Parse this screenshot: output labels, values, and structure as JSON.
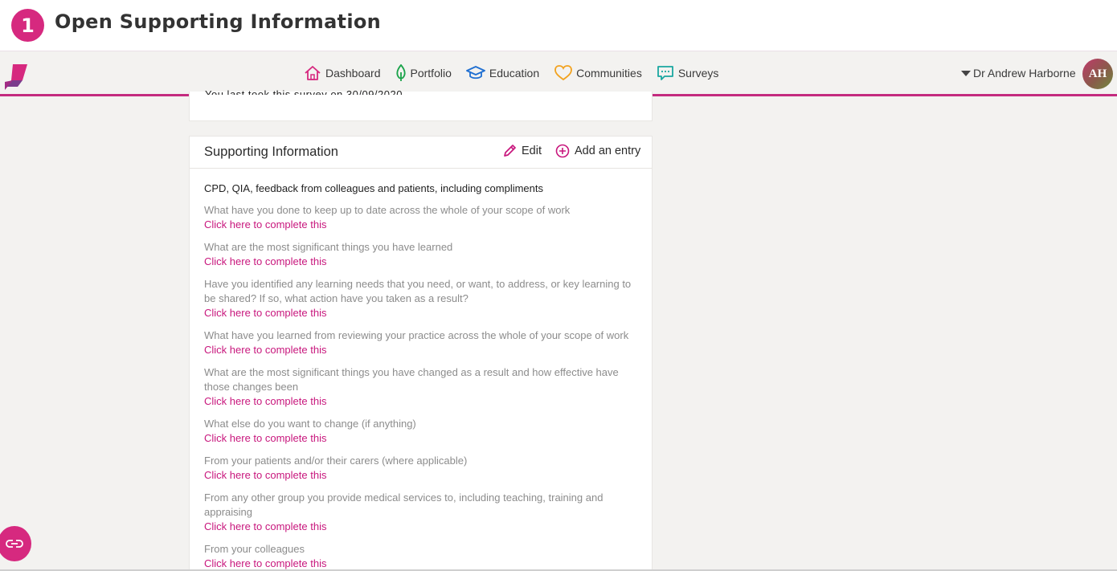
{
  "step": {
    "number": "1",
    "title": "Open Supporting Information"
  },
  "nav": {
    "items": [
      {
        "label": "Dashboard",
        "icon": "home-icon"
      },
      {
        "label": "Portfolio",
        "icon": "leaf-icon"
      },
      {
        "label": "Education",
        "icon": "graduation-cap-icon"
      },
      {
        "label": "Communities",
        "icon": "heart-icon"
      },
      {
        "label": "Surveys",
        "icon": "chat-icon"
      }
    ],
    "user_name": "Dr Andrew Harborne",
    "avatar_initials": "AH"
  },
  "top_card": {
    "clipped_text": "You last took this survey on 30/09/2020"
  },
  "supporting": {
    "title": "Supporting Information",
    "edit_label": "Edit",
    "add_label": "Add an entry",
    "section_heading": "CPD, QIA, feedback from colleagues and patients, including compliments",
    "questions": [
      {
        "text": "What have you done to keep up to date across the whole of your scope of work",
        "link": "Click here to complete this"
      },
      {
        "text": "What are the most significant things you have learned",
        "link": "Click here to complete this"
      },
      {
        "text": "Have you identified any learning needs that you need, or want, to address, or key learning to be shared? If so, what action have you taken as a result?",
        "link": "Click here to complete this"
      },
      {
        "text": "What have you learned from reviewing your practice across the whole of your scope of work",
        "link": "Click here to complete this"
      },
      {
        "text": "What are the most significant things you have changed as a result and how effective have those changes been",
        "link": "Click here to complete this"
      },
      {
        "text": "What else do you want to change (if anything)",
        "link": "Click here to complete this"
      },
      {
        "text": "From your patients and/or their carers (where applicable)",
        "link": "Click here to complete this"
      },
      {
        "text": "From any other group you provide medical services to, including teaching, training and appraising",
        "link": "Click here to complete this"
      },
      {
        "text": "From your colleagues",
        "link": "Click here to complete this"
      }
    ]
  },
  "colors": {
    "brand": "#c42b7f",
    "link": "#c8177d",
    "badge": "#d6297f"
  }
}
